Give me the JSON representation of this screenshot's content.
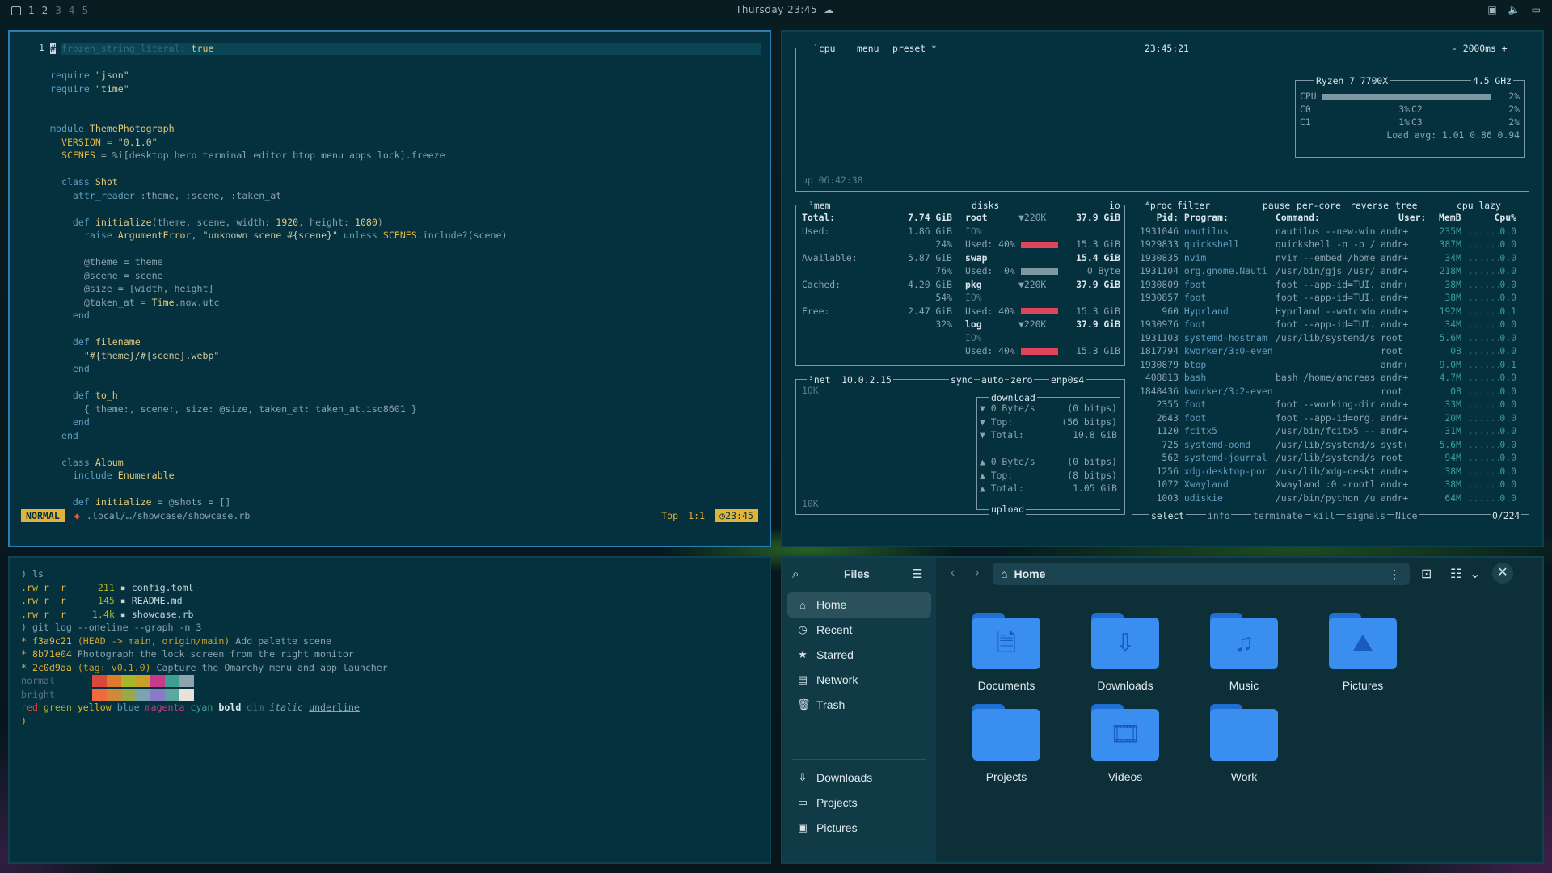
{
  "topbar": {
    "workspaces": [
      "1",
      "2",
      "3",
      "4",
      "5"
    ],
    "clock": "Thursday 23:45",
    "tray_icons": [
      "screen-icon",
      "volume-icon",
      "monitor-icon"
    ]
  },
  "nvim": {
    "line_number": "1",
    "status": {
      "mode": "NORMAL",
      "file": ".local/…/showcase/showcase.rb",
      "scroll": "Top",
      "position": "1:1",
      "time": "23:45"
    }
  },
  "terminal": {
    "prompt1": ") ls",
    "files": [
      {
        "perm": ".rw r  r",
        "size": "211",
        "name": "config.toml"
      },
      {
        "perm": ".rw r  r",
        "size": "145",
        "name": "README.md"
      },
      {
        "perm": ".rw r  r",
        "size": "1.4k",
        "name": "showcase.rb"
      }
    ],
    "prompt2": ") git log --oneline --graph -n 3",
    "commits": [
      {
        "hash": "f3a9c21",
        "ref": "(HEAD -> main, origin/main)",
        "msg": "Add palette scene"
      },
      {
        "hash": "8b71e04",
        "ref": "",
        "msg": "Photograph the lock screen from the right monitor"
      },
      {
        "hash": "2c0d9aa",
        "ref": "(tag: v0.1.0)",
        "msg": "Capture the Omarchy menu and app launcher"
      }
    ],
    "normal_label": "normal",
    "bright_label": "bright",
    "normal_colors": [
      "#05303e",
      "#d9483b",
      "#e07a2b",
      "#a9b52a",
      "#c7a12a",
      "#c73a8a",
      "#3aa08f",
      "#8fa3ad"
    ],
    "bright_colors": [
      "#05303e",
      "#f06a3c",
      "#cf8a38",
      "#9aa84a",
      "#7ba3b0",
      "#8a7bc8",
      "#5aa8a0",
      "#e9e2d8"
    ],
    "style_words": [
      "red",
      "green",
      "yellow",
      "blue",
      "magenta",
      "cyan",
      "bold",
      "dim",
      "italic",
      "underline"
    ],
    "prompt3": ")"
  },
  "btop": {
    "cpu_tab": "cpu",
    "menu_tab": "menu",
    "preset_tab": "preset *",
    "clock": "23:45:21",
    "interval": "2000ms",
    "uptime": "up 06:42:38",
    "cpu_name": "Ryzen 7 7700X",
    "freq": "4.5 GHz",
    "cpu_total": {
      "label": "CPU",
      "pct": "2%",
      "value": 0.02
    },
    "cores": [
      {
        "name": "C0",
        "pct": "3%"
      },
      {
        "name": "C2",
        "pct": "2%"
      },
      {
        "name": "C1",
        "pct": "1%"
      },
      {
        "name": "C3",
        "pct": "2%"
      }
    ],
    "load": "Load avg: 1.01 0.86 0.94",
    "mem": {
      "title": "mem",
      "total": "7.74 GiB",
      "used": "1.86 GiB",
      "used_pct": "24%",
      "available": "5.87 GiB",
      "avail_pct": "76%",
      "cached": "4.20 GiB",
      "cached_pct": "54%",
      "free": "2.47 GiB",
      "free_pct": "32%",
      "labels": {
        "total": "Total:",
        "used": "Used:",
        "available": "Available:",
        "cached": "Cached:",
        "free": "Free:"
      }
    },
    "disks": {
      "title": "disks",
      "io": "io",
      "items": [
        {
          "name": "root",
          "io": "▼220K",
          "size": "37.9 GiB",
          "used": "Used: 40%",
          "free": "15.3 GiB"
        },
        {
          "name": "swap",
          "io": "",
          "size": "15.4 GiB",
          "used": "Used:  0%",
          "free": "0 Byte"
        },
        {
          "name": "pkg",
          "io": "▼220K",
          "size": "37.9 GiB",
          "used": "Used: 40%",
          "free": "15.3 GiB"
        },
        {
          "name": "log",
          "io": "▼220K",
          "size": "37.9 GiB",
          "used": "Used: 40%",
          "free": "15.3 GiB"
        }
      ]
    },
    "net": {
      "title": "net",
      "ip": "10.0.2.15",
      "sync": "sync",
      "auto": "auto",
      "zero": "zero",
      "iface": "enp0s4",
      "scale_top": "10K",
      "scale_bottom": "10K",
      "download_label": "download",
      "upload_label": "upload",
      "down": [
        {
          "k": "▼ 0 Byte/s",
          "v": "(0 bitps)"
        },
        {
          "k": "▼ Top:",
          "v": "(56 bitps)"
        },
        {
          "k": "▼ Total:",
          "v": "10.8 GiB"
        }
      ],
      "up": [
        {
          "k": "▲ 0 Byte/s",
          "v": "(0 bitps)"
        },
        {
          "k": "▲ Top:",
          "v": "(8 bitps)"
        },
        {
          "k": "▲ Total:",
          "v": "1.05 GiB"
        }
      ]
    },
    "proc": {
      "title": "proc",
      "filter": "filter",
      "pause": "pause",
      "percore": "per-core",
      "reverse": "reverse",
      "tree": "tree",
      "sort": "cpu lazy",
      "headers": {
        "pid": "Pid:",
        "program": "Program:",
        "command": "Command:",
        "user": "User:",
        "mem": "MemB",
        "cpu": "Cpu%"
      },
      "rows": [
        [
          "1931046",
          "nautilus",
          "nautilus --new-win",
          "andr+",
          "235M",
          "0.0"
        ],
        [
          "1929833",
          "quickshell",
          "quickshell -n -p /",
          "andr+",
          "387M",
          "0.0"
        ],
        [
          "1930835",
          "nvim",
          "nvim --embed /home",
          "andr+",
          "34M",
          "0.0"
        ],
        [
          "1931104",
          "org.gnome.Nauti",
          "/usr/bin/gjs /usr/",
          "andr+",
          "218M",
          "0.0"
        ],
        [
          "1930809",
          "foot",
          "foot --app-id=TUI.",
          "andr+",
          "38M",
          "0.0"
        ],
        [
          "1930857",
          "foot",
          "foot --app-id=TUI.",
          "andr+",
          "38M",
          "0.0"
        ],
        [
          "960",
          "Hyprland",
          "Hyprland --watchdo",
          "andr+",
          "192M",
          "0.1"
        ],
        [
          "1930976",
          "foot",
          "foot --app-id=TUI.",
          "andr+",
          "34M",
          "0.0"
        ],
        [
          "1931103",
          "systemd-hostnam",
          "/usr/lib/systemd/s",
          "root",
          "5.6M",
          "0.0"
        ],
        [
          "1817794",
          "kworker/3:0-even",
          "",
          "root",
          "0B",
          "0.0"
        ],
        [
          "1930879",
          "btop",
          "",
          "andr+",
          "9.0M",
          "0.1"
        ],
        [
          "408813",
          "bash",
          "bash /home/andreas",
          "andr+",
          "4.7M",
          "0.0"
        ],
        [
          "1848436",
          "kworker/3:2-even",
          "",
          "root",
          "0B",
          "0.0"
        ],
        [
          "2355",
          "foot",
          "foot --working-dir",
          "andr+",
          "33M",
          "0.0"
        ],
        [
          "2643",
          "foot",
          "foot --app-id=org.",
          "andr+",
          "20M",
          "0.0"
        ],
        [
          "1120",
          "fcitx5",
          "/usr/bin/fcitx5 --",
          "andr+",
          "31M",
          "0.0"
        ],
        [
          "725",
          "systemd-oomd",
          "/usr/lib/systemd/s",
          "syst+",
          "5.6M",
          "0.0"
        ],
        [
          "562",
          "systemd-journal",
          "/usr/lib/systemd/s",
          "root",
          "94M",
          "0.0"
        ],
        [
          "1256",
          "xdg-desktop-por",
          "/usr/lib/xdg-deskt",
          "andr+",
          "38M",
          "0.0"
        ],
        [
          "1072",
          "Xwayland",
          "Xwayland :0 -rootl",
          "andr+",
          "38M",
          "0.0"
        ],
        [
          "1003",
          "udiskie",
          "/usr/bin/python /u",
          "andr+",
          "64M",
          "0.0"
        ]
      ],
      "footer": {
        "select": "select",
        "info": "info",
        "terminate": "terminate",
        "kill": "kill",
        "signals": "signals",
        "nice": "Nice",
        "count": "0/224"
      }
    }
  },
  "files": {
    "sidebar_title": "Files",
    "nav": [
      {
        "label": "Home",
        "icon": "home-icon",
        "glyph": "⌂"
      },
      {
        "label": "Recent",
        "icon": "clock-icon",
        "glyph": "◷"
      },
      {
        "label": "Starred",
        "icon": "star-icon",
        "glyph": "★"
      },
      {
        "label": "Network",
        "icon": "network-icon",
        "glyph": "▤"
      },
      {
        "label": "Trash",
        "icon": "trash-icon",
        "glyph": "🗑"
      }
    ],
    "bookmarks": [
      {
        "label": "Downloads",
        "icon": "download-icon",
        "glyph": "⇩"
      },
      {
        "label": "Projects",
        "icon": "folder-icon",
        "glyph": "▭"
      },
      {
        "label": "Pictures",
        "icon": "image-icon",
        "glyph": "▣"
      }
    ],
    "location": "Home",
    "folders": [
      {
        "label": "Documents",
        "glyph": "🗎"
      },
      {
        "label": "Downloads",
        "glyph": "⇩"
      },
      {
        "label": "Music",
        "glyph": "♫"
      },
      {
        "label": "Pictures",
        "glyph": "⛰"
      },
      {
        "label": "Projects",
        "glyph": ""
      },
      {
        "label": "Videos",
        "glyph": "🎞"
      },
      {
        "label": "Work",
        "glyph": ""
      }
    ]
  }
}
